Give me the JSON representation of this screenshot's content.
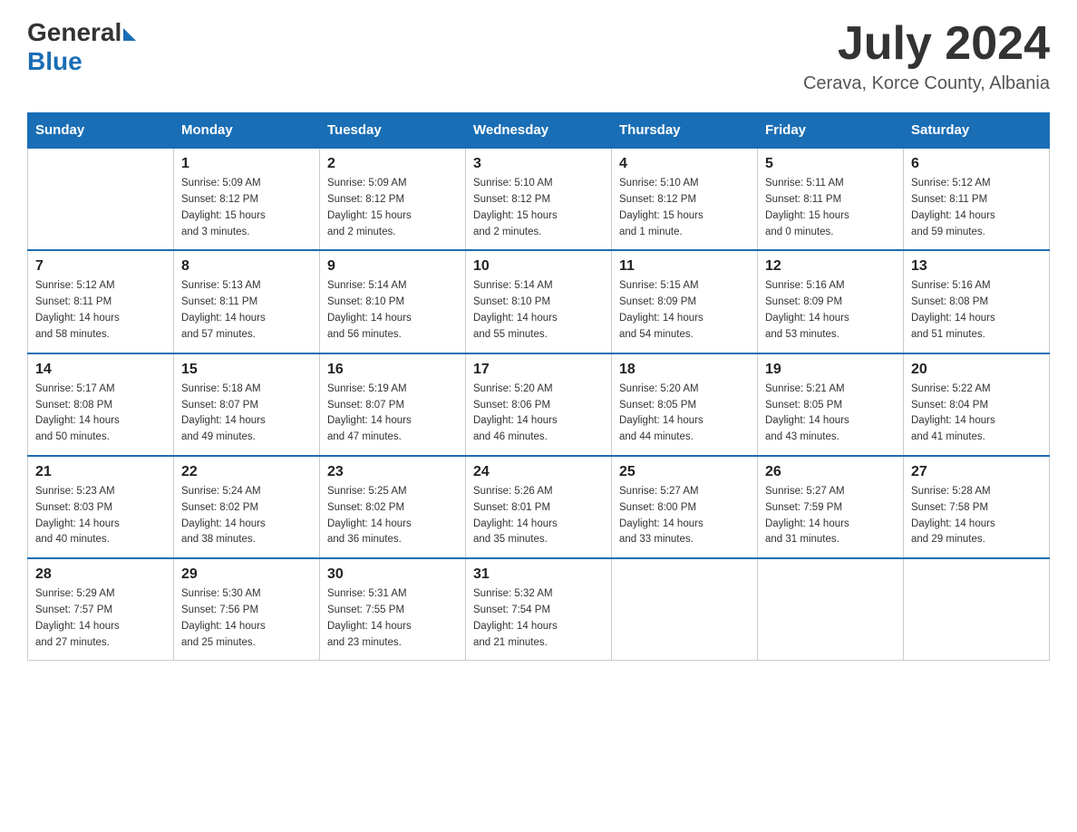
{
  "logo": {
    "general": "General",
    "blue": "Blue"
  },
  "title": "July 2024",
  "location": "Cerava, Korce County, Albania",
  "days_header": [
    "Sunday",
    "Monday",
    "Tuesday",
    "Wednesday",
    "Thursday",
    "Friday",
    "Saturday"
  ],
  "weeks": [
    [
      {
        "day": "",
        "detail": ""
      },
      {
        "day": "1",
        "detail": "Sunrise: 5:09 AM\nSunset: 8:12 PM\nDaylight: 15 hours\nand 3 minutes."
      },
      {
        "day": "2",
        "detail": "Sunrise: 5:09 AM\nSunset: 8:12 PM\nDaylight: 15 hours\nand 2 minutes."
      },
      {
        "day": "3",
        "detail": "Sunrise: 5:10 AM\nSunset: 8:12 PM\nDaylight: 15 hours\nand 2 minutes."
      },
      {
        "day": "4",
        "detail": "Sunrise: 5:10 AM\nSunset: 8:12 PM\nDaylight: 15 hours\nand 1 minute."
      },
      {
        "day": "5",
        "detail": "Sunrise: 5:11 AM\nSunset: 8:11 PM\nDaylight: 15 hours\nand 0 minutes."
      },
      {
        "day": "6",
        "detail": "Sunrise: 5:12 AM\nSunset: 8:11 PM\nDaylight: 14 hours\nand 59 minutes."
      }
    ],
    [
      {
        "day": "7",
        "detail": "Sunrise: 5:12 AM\nSunset: 8:11 PM\nDaylight: 14 hours\nand 58 minutes."
      },
      {
        "day": "8",
        "detail": "Sunrise: 5:13 AM\nSunset: 8:11 PM\nDaylight: 14 hours\nand 57 minutes."
      },
      {
        "day": "9",
        "detail": "Sunrise: 5:14 AM\nSunset: 8:10 PM\nDaylight: 14 hours\nand 56 minutes."
      },
      {
        "day": "10",
        "detail": "Sunrise: 5:14 AM\nSunset: 8:10 PM\nDaylight: 14 hours\nand 55 minutes."
      },
      {
        "day": "11",
        "detail": "Sunrise: 5:15 AM\nSunset: 8:09 PM\nDaylight: 14 hours\nand 54 minutes."
      },
      {
        "day": "12",
        "detail": "Sunrise: 5:16 AM\nSunset: 8:09 PM\nDaylight: 14 hours\nand 53 minutes."
      },
      {
        "day": "13",
        "detail": "Sunrise: 5:16 AM\nSunset: 8:08 PM\nDaylight: 14 hours\nand 51 minutes."
      }
    ],
    [
      {
        "day": "14",
        "detail": "Sunrise: 5:17 AM\nSunset: 8:08 PM\nDaylight: 14 hours\nand 50 minutes."
      },
      {
        "day": "15",
        "detail": "Sunrise: 5:18 AM\nSunset: 8:07 PM\nDaylight: 14 hours\nand 49 minutes."
      },
      {
        "day": "16",
        "detail": "Sunrise: 5:19 AM\nSunset: 8:07 PM\nDaylight: 14 hours\nand 47 minutes."
      },
      {
        "day": "17",
        "detail": "Sunrise: 5:20 AM\nSunset: 8:06 PM\nDaylight: 14 hours\nand 46 minutes."
      },
      {
        "day": "18",
        "detail": "Sunrise: 5:20 AM\nSunset: 8:05 PM\nDaylight: 14 hours\nand 44 minutes."
      },
      {
        "day": "19",
        "detail": "Sunrise: 5:21 AM\nSunset: 8:05 PM\nDaylight: 14 hours\nand 43 minutes."
      },
      {
        "day": "20",
        "detail": "Sunrise: 5:22 AM\nSunset: 8:04 PM\nDaylight: 14 hours\nand 41 minutes."
      }
    ],
    [
      {
        "day": "21",
        "detail": "Sunrise: 5:23 AM\nSunset: 8:03 PM\nDaylight: 14 hours\nand 40 minutes."
      },
      {
        "day": "22",
        "detail": "Sunrise: 5:24 AM\nSunset: 8:02 PM\nDaylight: 14 hours\nand 38 minutes."
      },
      {
        "day": "23",
        "detail": "Sunrise: 5:25 AM\nSunset: 8:02 PM\nDaylight: 14 hours\nand 36 minutes."
      },
      {
        "day": "24",
        "detail": "Sunrise: 5:26 AM\nSunset: 8:01 PM\nDaylight: 14 hours\nand 35 minutes."
      },
      {
        "day": "25",
        "detail": "Sunrise: 5:27 AM\nSunset: 8:00 PM\nDaylight: 14 hours\nand 33 minutes."
      },
      {
        "day": "26",
        "detail": "Sunrise: 5:27 AM\nSunset: 7:59 PM\nDaylight: 14 hours\nand 31 minutes."
      },
      {
        "day": "27",
        "detail": "Sunrise: 5:28 AM\nSunset: 7:58 PM\nDaylight: 14 hours\nand 29 minutes."
      }
    ],
    [
      {
        "day": "28",
        "detail": "Sunrise: 5:29 AM\nSunset: 7:57 PM\nDaylight: 14 hours\nand 27 minutes."
      },
      {
        "day": "29",
        "detail": "Sunrise: 5:30 AM\nSunset: 7:56 PM\nDaylight: 14 hours\nand 25 minutes."
      },
      {
        "day": "30",
        "detail": "Sunrise: 5:31 AM\nSunset: 7:55 PM\nDaylight: 14 hours\nand 23 minutes."
      },
      {
        "day": "31",
        "detail": "Sunrise: 5:32 AM\nSunset: 7:54 PM\nDaylight: 14 hours\nand 21 minutes."
      },
      {
        "day": "",
        "detail": ""
      },
      {
        "day": "",
        "detail": ""
      },
      {
        "day": "",
        "detail": ""
      }
    ]
  ]
}
